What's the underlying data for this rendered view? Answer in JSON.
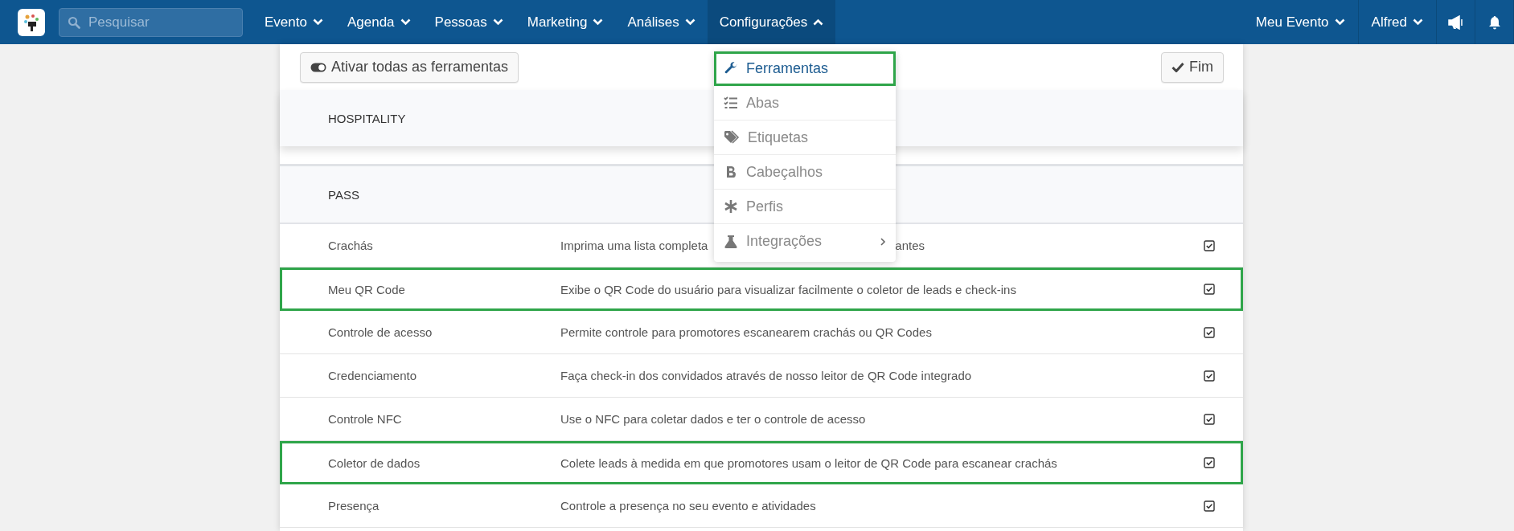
{
  "navbar": {
    "search": {
      "placeholder": "Pesquisar"
    },
    "menus": [
      {
        "label": "Evento",
        "expanded": false
      },
      {
        "label": "Agenda",
        "expanded": false
      },
      {
        "label": "Pessoas",
        "expanded": false
      },
      {
        "label": "Marketing",
        "expanded": false
      },
      {
        "label": "Análises",
        "expanded": false
      },
      {
        "label": "Configurações",
        "expanded": true
      }
    ],
    "right_menus": [
      {
        "label": "Meu Evento",
        "expanded": false
      },
      {
        "label": "Alfred",
        "expanded": false
      }
    ]
  },
  "toolbar": {
    "toggle_all_button": "Ativar todas as ferramentas",
    "done_button": "Fim"
  },
  "settings_menu": [
    {
      "label": "Ferramentas",
      "selected": true,
      "highlighted": true,
      "kind": "wrench"
    },
    {
      "label": "Abas",
      "selected": false,
      "highlighted": false,
      "kind": "list"
    },
    {
      "label": "Etiquetas",
      "selected": false,
      "highlighted": false,
      "kind": "tags"
    },
    {
      "label": "Cabeçalhos",
      "selected": false,
      "highlighted": false,
      "kind": "bold"
    },
    {
      "label": "Perfis",
      "selected": false,
      "highlighted": false,
      "kind": "asterisk"
    },
    {
      "label": "Integrações",
      "selected": false,
      "highlighted": false,
      "kind": "flask",
      "submenu": true
    }
  ],
  "sections": [
    {
      "title": "HOSPITALITY"
    },
    {
      "title": "PASS",
      "rows": [
        {
          "name": "Crachás",
          "description": "Imprima uma lista completa",
          "description_tail": "antes",
          "checked": true,
          "highlighted": false
        },
        {
          "name": "Meu QR Code",
          "description": "Exibe o QR Code do usuário para visualizar facilmente o coletor de leads e check-ins",
          "checked": true,
          "highlighted": true
        },
        {
          "name": "Controle de acesso",
          "description": "Permite controle para promotores escanearem crachás ou QR Codes",
          "checked": true,
          "highlighted": false
        },
        {
          "name": "Credenciamento",
          "description": "Faça check-in dos convidados através de nosso leitor de QR Code integrado",
          "checked": true,
          "highlighted": false
        },
        {
          "name": "Controle NFC",
          "description": "Use o NFC para coletar dados e ter o controle de acesso",
          "checked": true,
          "highlighted": false
        },
        {
          "name": "Coletor de dados",
          "description": "Colete leads à medida em que promotores usam o leitor de QR Code para escanear crachás",
          "checked": true,
          "highlighted": true
        },
        {
          "name": "Presença",
          "description": "Controle a presença no seu evento e atividades",
          "checked": true,
          "highlighted": false
        }
      ]
    }
  ]
}
